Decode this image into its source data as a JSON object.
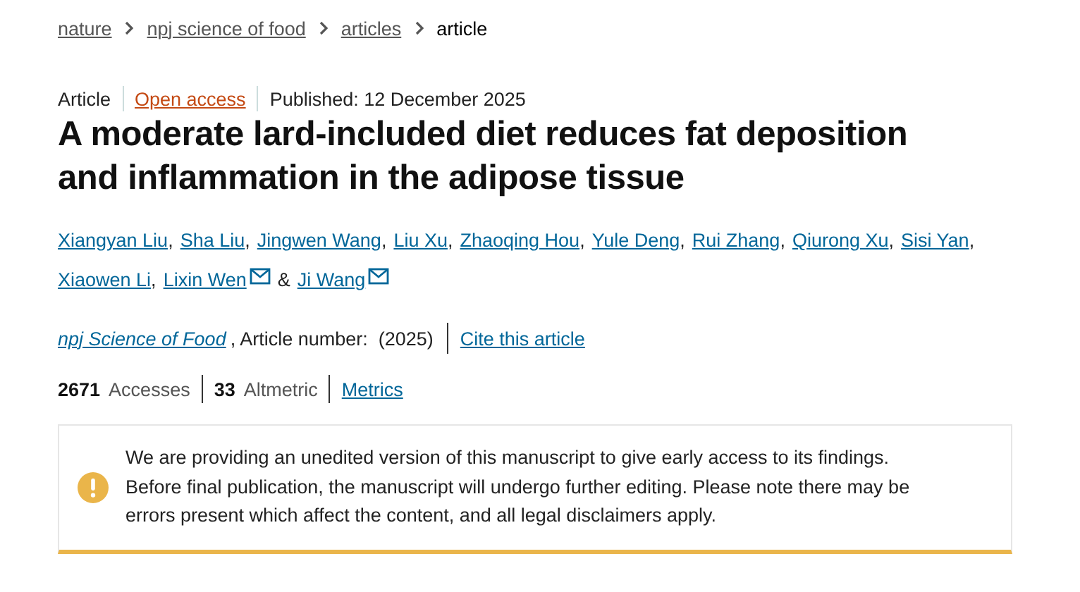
{
  "breadcrumbs": [
    {
      "label": "nature",
      "link": true
    },
    {
      "label": "npj science of food",
      "link": true
    },
    {
      "label": "articles",
      "link": true
    },
    {
      "label": "article",
      "link": false
    }
  ],
  "meta": {
    "type": "Article",
    "access": "Open access",
    "published": "Published: 12 December 2025"
  },
  "title": "A moderate lard-included diet reduces fat deposition and inflammation in the adipose tissue",
  "authors": [
    {
      "name": "Xiangyan Liu",
      "email": false,
      "after": ","
    },
    {
      "name": "Sha Liu",
      "email": false,
      "after": ","
    },
    {
      "name": "Jingwen Wang",
      "email": false,
      "after": ","
    },
    {
      "name": "Liu Xu",
      "email": false,
      "after": ","
    },
    {
      "name": "Zhaoqing Hou",
      "email": false,
      "after": ","
    },
    {
      "name": "Yule Deng",
      "email": false,
      "after": ","
    },
    {
      "name": "Rui Zhang",
      "email": false,
      "after": ","
    },
    {
      "name": "Qiurong Xu",
      "email": false,
      "after": ","
    },
    {
      "name": "Sisi Yan",
      "email": false,
      "after": ","
    },
    {
      "name": "Xiaowen Li",
      "email": false,
      "after": ","
    },
    {
      "name": "Lixin Wen",
      "email": true,
      "after": "&"
    },
    {
      "name": "Ji Wang",
      "email": true
    }
  ],
  "citation": {
    "journal": "npj Science of Food",
    "details": ", Article number:  (2025)",
    "cite": "Cite this article"
  },
  "metrics": [
    {
      "text": "**2671** Accesses",
      "kind": "stat"
    },
    {
      "text": "**33** Altmetric",
      "kind": "stat"
    },
    {
      "text": "Metrics",
      "kind": "link"
    }
  ],
  "notice": {
    "text": "We are providing an unedited version of this manuscript to give early access to its findings. Before final publication, the manuscript will undergo further editing. Please note there may be errors present which affect the content, and all legal disclaimers apply."
  }
}
